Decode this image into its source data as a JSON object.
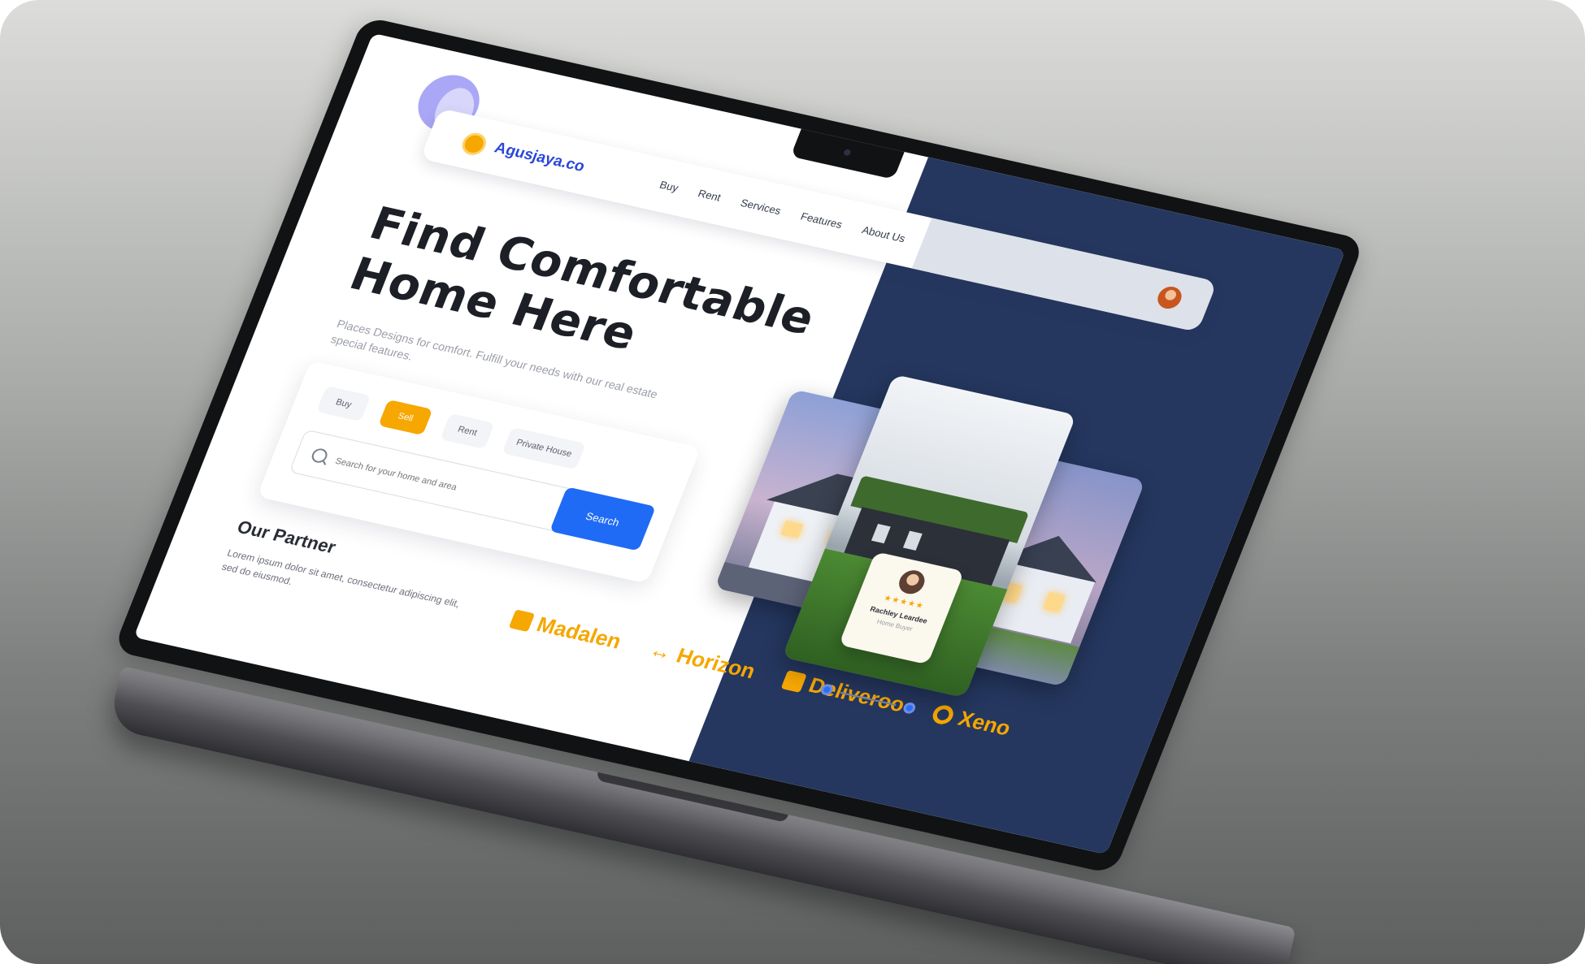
{
  "logo": {
    "text": "Agusjaya.co"
  },
  "nav": {
    "links": [
      "Buy",
      "Rent",
      "Services",
      "Features",
      "About Us"
    ]
  },
  "hero": {
    "title_line1": "Find Comfortable",
    "title_line2": "Home Here",
    "subtitle": "Places Designs for comfort. Fulfill your needs with our real estate special features."
  },
  "search": {
    "tabs": [
      "Buy",
      "Sell",
      "Rent",
      "Private House"
    ],
    "active_tab": "Sell",
    "placeholder": "Search for your home and area",
    "button_label": "Search"
  },
  "partners": {
    "title": "Our Partner",
    "description": "Lorem ipsum dolor sit amet, consectetur adipiscing elit, sed do eiusmod.",
    "brands": [
      "Madalen",
      "Horizon",
      "Deliveroo",
      "Xeno"
    ]
  },
  "review": {
    "stars": "★★★★★",
    "name": "Rachley Leardee",
    "role": "Home Buyer"
  },
  "colors": {
    "accent": "#f6a700",
    "primary": "#1f6bf5",
    "panel": "#25375f"
  }
}
